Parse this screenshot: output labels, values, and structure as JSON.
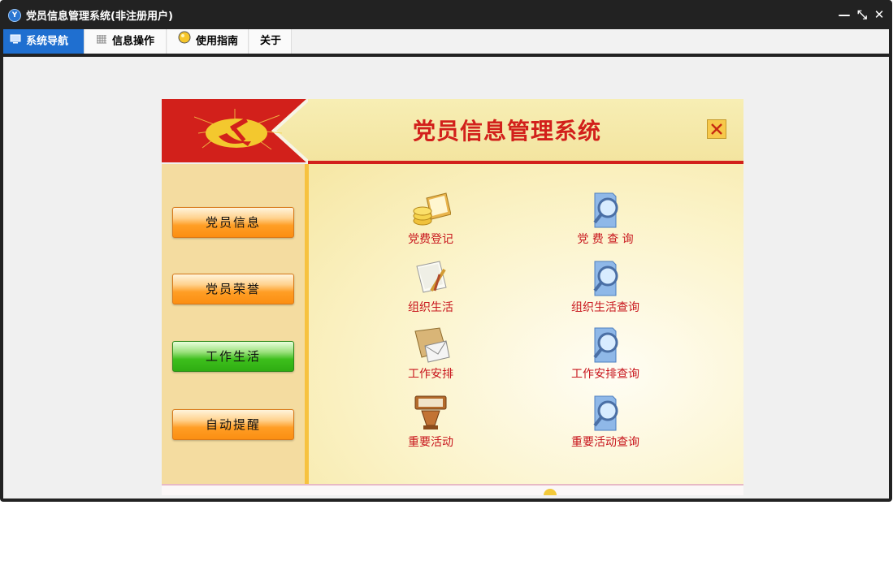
{
  "window": {
    "title": "党员信息管理系统(非注册用户)",
    "app_icon_letter": "Y",
    "controls": {
      "minimize": "—",
      "restore": "⤡",
      "close": "✕"
    }
  },
  "menu": {
    "tabs": [
      {
        "label": "系统导航",
        "icon": "monitor-icon",
        "active": true
      },
      {
        "label": "信息操作",
        "icon": "grid-icon",
        "active": false
      },
      {
        "label": "使用指南",
        "icon": "bulb-icon",
        "active": false
      },
      {
        "label": "关于",
        "icon": "",
        "active": false
      }
    ]
  },
  "panel": {
    "title": "党员信息管理系统",
    "sidebar": [
      {
        "label": "党员信息",
        "style": "orange"
      },
      {
        "label": "党员荣誉",
        "style": "orange"
      },
      {
        "label": "工作生活",
        "style": "green"
      },
      {
        "label": "自动提醒",
        "style": "orange"
      }
    ],
    "functions": [
      {
        "label": "党费登记",
        "icon": "coins-laptop-icon"
      },
      {
        "label": "党  费  查  询",
        "icon": "search-document-icon"
      },
      {
        "label": "组织生活",
        "icon": "paper-pencil-icon"
      },
      {
        "label": "组织生活查询",
        "icon": "search-document-icon"
      },
      {
        "label": "工作安排",
        "icon": "envelope-icon"
      },
      {
        "label": "工作安排查询",
        "icon": "search-document-icon"
      },
      {
        "label": "重要活动",
        "icon": "podium-icon"
      },
      {
        "label": "重要活动查询",
        "icon": "search-document-icon"
      }
    ]
  },
  "colors": {
    "accent_red": "#d2201b",
    "tab_active": "#1f6fd0",
    "label_red": "#c8161d"
  }
}
